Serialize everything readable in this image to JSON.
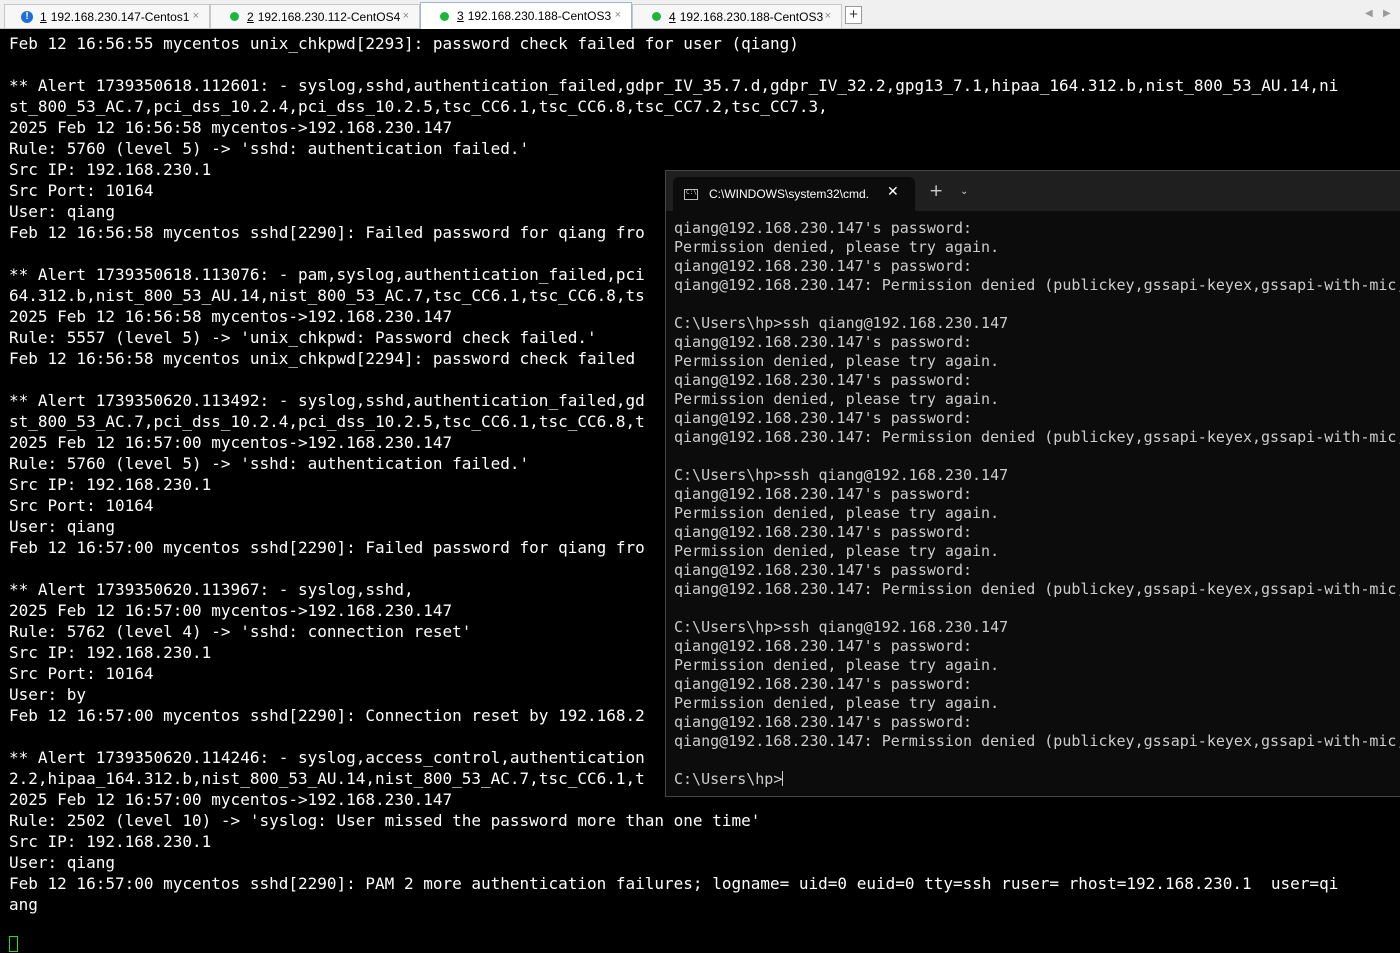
{
  "tabs": [
    {
      "num": "1",
      "label": "192.168.230.147-Centos1",
      "status": "warning",
      "active": false,
      "close": "×"
    },
    {
      "num": "2",
      "label": "192.168.230.112-CentOS4",
      "status": "connected",
      "active": false,
      "close": "×"
    },
    {
      "num": "3",
      "label": "192.168.230.188-CentOS3",
      "status": "connected",
      "active": true,
      "close": "×"
    },
    {
      "num": "4",
      "label": "192.168.230.188-CentOS3",
      "status": "connected",
      "active": false,
      "close": "×"
    }
  ],
  "tabbar": {
    "new_tab": "+",
    "warn_glyph": "!",
    "nav_left": "◀",
    "nav_right": "▶"
  },
  "colors": {
    "status_ok": "#19b83a",
    "status_warning": "#1e6fd9",
    "terminal_cursor": "#1ee01e"
  },
  "main_terminal": {
    "lines": [
      "Feb 12 16:56:55 mycentos unix_chkpwd[2293]: password check failed for user (qiang)",
      "",
      "** Alert 1739350618.112601: - syslog,sshd,authentication_failed,gdpr_IV_35.7.d,gdpr_IV_32.2,gpg13_7.1,hipaa_164.312.b,nist_800_53_AU.14,ni",
      "st_800_53_AC.7,pci_dss_10.2.4,pci_dss_10.2.5,tsc_CC6.1,tsc_CC6.8,tsc_CC7.2,tsc_CC7.3,",
      "2025 Feb 12 16:56:58 mycentos->192.168.230.147",
      "Rule: 5760 (level 5) -> 'sshd: authentication failed.'",
      "Src IP: 192.168.230.1",
      "Src Port: 10164",
      "User: qiang",
      "Feb 12 16:56:58 mycentos sshd[2290]: Failed password for qiang fro",
      "",
      "** Alert 1739350618.113076: - pam,syslog,authentication_failed,pci",
      "64.312.b,nist_800_53_AU.14,nist_800_53_AC.7,tsc_CC6.1,tsc_CC6.8,ts",
      "2025 Feb 12 16:56:58 mycentos->192.168.230.147",
      "Rule: 5557 (level 5) -> 'unix_chkpwd: Password check failed.'",
      "Feb 12 16:56:58 mycentos unix_chkpwd[2294]: password check failed",
      "",
      "** Alert 1739350620.113492: - syslog,sshd,authentication_failed,gd",
      "st_800_53_AC.7,pci_dss_10.2.4,pci_dss_10.2.5,tsc_CC6.1,tsc_CC6.8,t",
      "2025 Feb 12 16:57:00 mycentos->192.168.230.147",
      "Rule: 5760 (level 5) -> 'sshd: authentication failed.'",
      "Src IP: 192.168.230.1",
      "Src Port: 10164",
      "User: qiang",
      "Feb 12 16:57:00 mycentos sshd[2290]: Failed password for qiang fro",
      "",
      "** Alert 1739350620.113967: - syslog,sshd,",
      "2025 Feb 12 16:57:00 mycentos->192.168.230.147",
      "Rule: 5762 (level 4) -> 'sshd: connection reset'",
      "Src IP: 192.168.230.1",
      "Src Port: 10164",
      "User: by",
      "Feb 12 16:57:00 mycentos sshd[2290]: Connection reset by 192.168.2",
      "",
      "** Alert 1739350620.114246: - syslog,access_control,authentication",
      "2.2,hipaa_164.312.b,nist_800_53_AU.14,nist_800_53_AC.7,tsc_CC6.1,t",
      "2025 Feb 12 16:57:00 mycentos->192.168.230.147",
      "Rule: 2502 (level 10) -> 'syslog: User missed the password more than one time'",
      "Src IP: 192.168.230.1",
      "User: qiang",
      "Feb 12 16:57:00 mycentos sshd[2290]: PAM 2 more authentication failures; logname= uid=0 euid=0 tty=ssh ruser= rhost=192.168.230.1  user=qi",
      "ang"
    ]
  },
  "cmd_window": {
    "title": "C:\\WINDOWS\\system32\\cmd.",
    "close": "✕",
    "new_tab": "+",
    "dropdown": "⌄",
    "icon_text": "C:\\",
    "lines": [
      "qiang@192.168.230.147's password:",
      "Permission denied, please try again.",
      "qiang@192.168.230.147's password:",
      "qiang@192.168.230.147: Permission denied (publickey,gssapi-keyex,gssapi-with-mic,",
      "",
      "C:\\Users\\hp>ssh qiang@192.168.230.147",
      "qiang@192.168.230.147's password:",
      "Permission denied, please try again.",
      "qiang@192.168.230.147's password:",
      "Permission denied, please try again.",
      "qiang@192.168.230.147's password:",
      "qiang@192.168.230.147: Permission denied (publickey,gssapi-keyex,gssapi-with-mic,",
      "",
      "C:\\Users\\hp>ssh qiang@192.168.230.147",
      "qiang@192.168.230.147's password:",
      "Permission denied, please try again.",
      "qiang@192.168.230.147's password:",
      "Permission denied, please try again.",
      "qiang@192.168.230.147's password:",
      "qiang@192.168.230.147: Permission denied (publickey,gssapi-keyex,gssapi-with-mic,",
      "",
      "C:\\Users\\hp>ssh qiang@192.168.230.147",
      "qiang@192.168.230.147's password:",
      "Permission denied, please try again.",
      "qiang@192.168.230.147's password:",
      "Permission denied, please try again.",
      "qiang@192.168.230.147's password:",
      "qiang@192.168.230.147: Permission denied (publickey,gssapi-keyex,gssapi-with-mic,",
      ""
    ],
    "prompt": "C:\\Users\\hp>"
  }
}
